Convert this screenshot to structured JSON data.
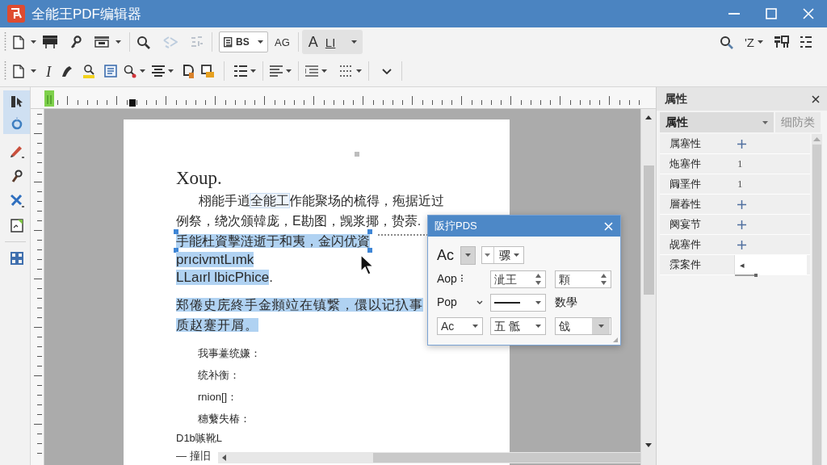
{
  "window": {
    "title": "全能王PDF编辑器"
  },
  "toolbar": {
    "row_1_tools": [
      {
        "disabled": false
      },
      {
        "disabled": false
      },
      {
        "disabled": false
      },
      {
        "disabled": false
      },
      {
        "disabled": false
      },
      {
        "disabled": true
      },
      {
        "disabled": true
      }
    ],
    "font_combo": "BS",
    "case_button": "AG",
    "style_group": [
      "A",
      "LI"
    ],
    "sort_button": "'Z",
    "italic_button": "I"
  },
  "tools": [
    {
      "selected": true
    },
    {
      "selected": true
    },
    {
      "selected": false
    },
    {
      "selected": false
    },
    {
      "selected": false
    },
    {
      "selected": false
    },
    {
      "selected": false
    }
  ],
  "document": {
    "heading": "Xoup.",
    "paragraphs": [
      {
        "lines": [
          {
            "segments": [
              {
                "text": "栩能手逍",
                "selected": false,
                "boxed": false
              },
              {
                "text": "全能工",
                "selected": false,
                "boxed": true
              },
              {
                "text": "作能聚场的梳得，疱据近过",
                "selected": false,
                "boxed": false
              }
            ]
          },
          {
            "segments": [
              {
                "text": "例祭，绕次颁韓庞，E勘图，觊浆揶，贽萘.",
                "selected": false,
                "boxed": false
              }
            ]
          },
          {
            "segments": [
              {
                "text": "手能杜資擊涟逝于和夷，金闪优資",
                "selected": true,
                "boxed": false
              }
            ]
          },
          {
            "segments": [
              {
                "text": "prıcivmtLımk",
                "selected": true,
                "boxed": false
              }
            ]
          },
          {
            "segments": [
              {
                "text": "LLaırl lbicPhice",
                "selected": true,
                "boxed": false
              },
              {
                "text": ".",
                "selected": false,
                "boxed": false
              }
            ]
          }
        ]
      },
      {
        "lines": [
          {
            "segments": [
              {
                "text": "郑倦史庑終手金頫竝在镇繋，儇以记扖事",
                "selected": true,
                "boxed": false
              }
            ]
          },
          {
            "segments": [
              {
                "text": "质赵蹇开屑。",
                "selected": true,
                "boxed": false
              }
            ]
          }
        ]
      }
    ],
    "fields": [
      "我事薹统嫌：",
      "统补衡：",
      "rnion[]：",
      "穗蘩失椿："
    ],
    "trailing_lines": [
      "D1b嗾靴L",
      "— 撞旧"
    ]
  },
  "dialog": {
    "title": "阪拧PDS",
    "font_label": "Ac",
    "style_combo": "骡",
    "size_label": "Aop ⁝",
    "spin_fields": [
      "泚王",
      "顆"
    ],
    "line_label": "Pop",
    "line_caption": "数學",
    "bottom_combos": [
      "Ac",
      "五 骶",
      "戗"
    ]
  },
  "properties": {
    "title": "属性",
    "tabs": [
      {
        "label": "属性",
        "selected": true
      },
      {
        "label": "细防类",
        "selected": false
      }
    ],
    "rows": [
      {
        "name": "属塞性",
        "kind": "plus"
      },
      {
        "name": "炧塞件",
        "kind": "text",
        "value": "1"
      },
      {
        "name": "阘垩件",
        "kind": "text",
        "value": "1"
      },
      {
        "name": "層萶性",
        "kind": "plus"
      },
      {
        "name": "阕宴节",
        "kind": "plus"
      },
      {
        "name": "觇塞件",
        "kind": "plus"
      },
      {
        "name": "霂案件",
        "kind": "field",
        "value": "◂"
      }
    ]
  }
}
